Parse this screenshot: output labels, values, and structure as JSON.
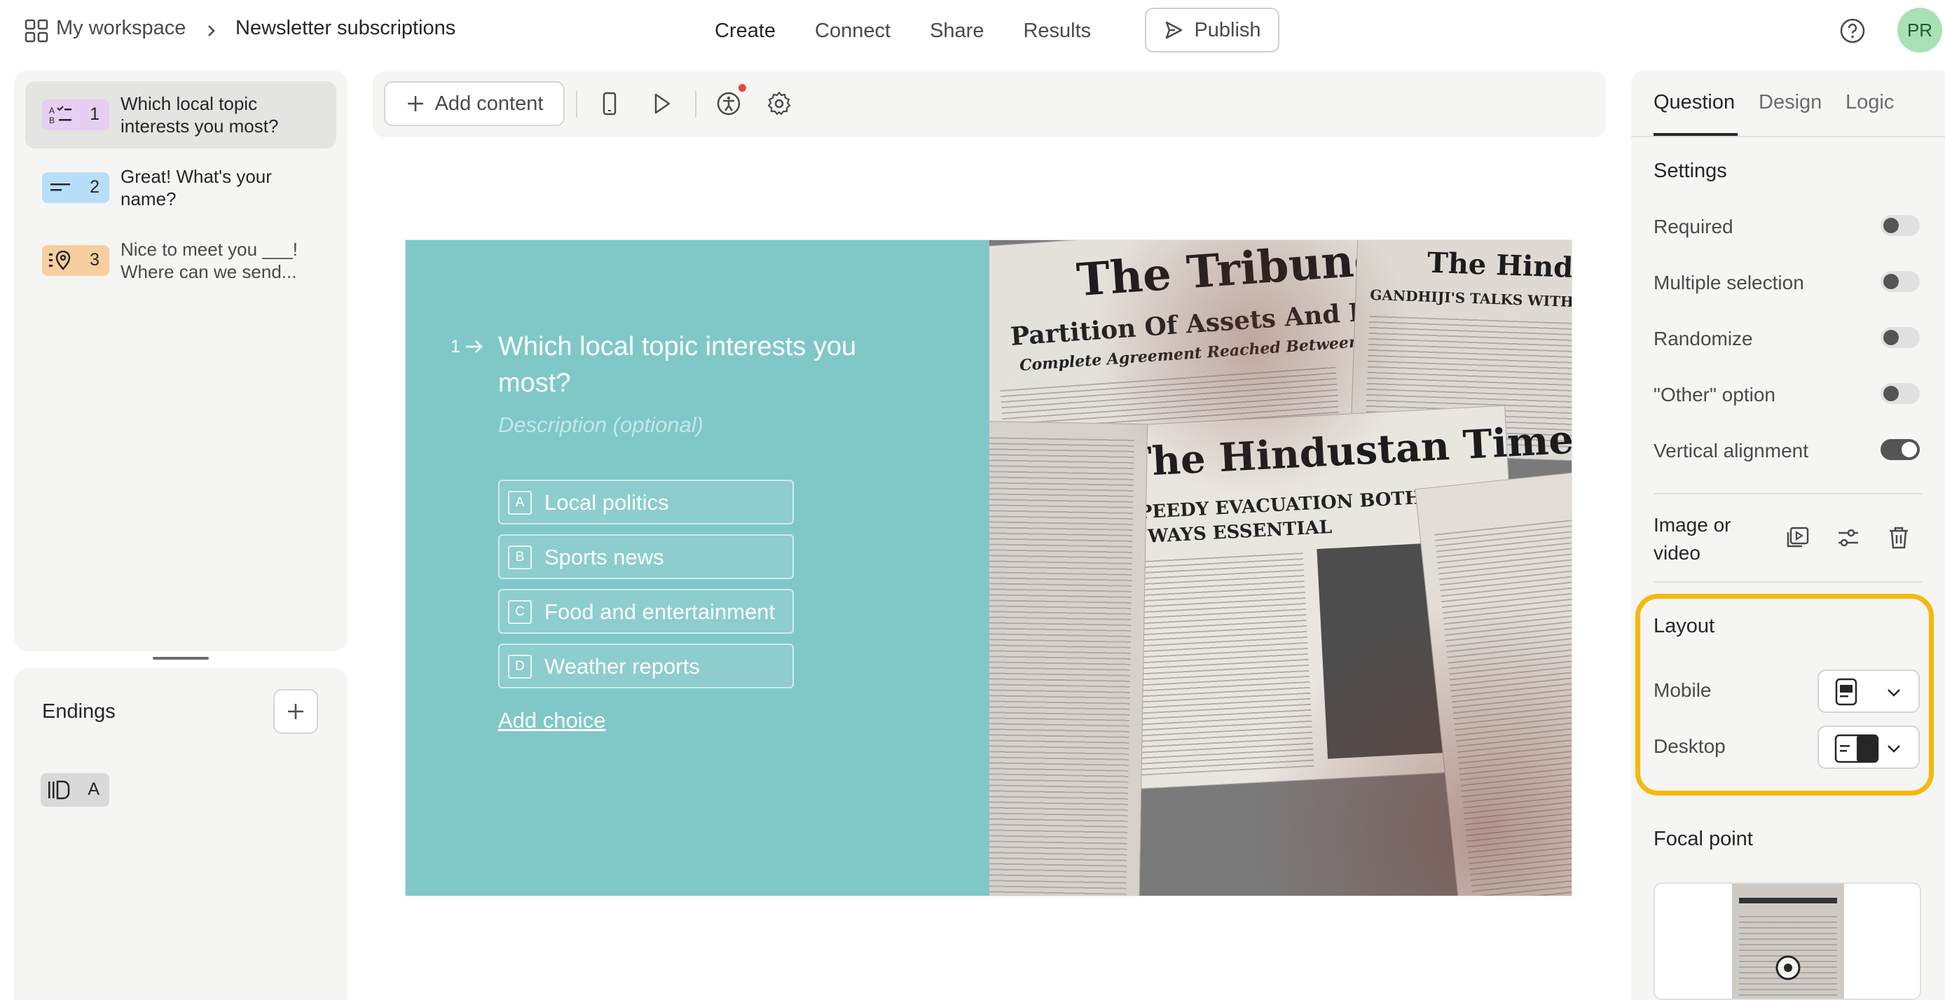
{
  "header": {
    "workspace": "My workspace",
    "form_name": "Newsletter subscriptions",
    "nav": [
      "Create",
      "Connect",
      "Share",
      "Results"
    ],
    "publish_label": "Publish",
    "avatar_initials": "PR"
  },
  "questions": [
    {
      "num": "1",
      "text": "Which local topic interests you most?",
      "color": "#e6cff2",
      "icon": "multiple-choice-icon"
    },
    {
      "num": "2",
      "text": "Great! What's your name?",
      "color": "#b8defa",
      "icon": "short-text-icon"
    },
    {
      "num": "3",
      "text": "Nice to meet you ___! Where can we send...",
      "color": "#f7cf9f",
      "icon": "address-icon"
    }
  ],
  "endings": {
    "title": "Endings",
    "item_label": "A"
  },
  "toolbar": {
    "add_content_label": "Add content"
  },
  "preview": {
    "question_number": "1",
    "question_title": "Which local topic interests you most?",
    "description_placeholder": "Description (optional)",
    "choices": [
      {
        "key": "A",
        "label": "Local politics"
      },
      {
        "key": "B",
        "label": "Sports news"
      },
      {
        "key": "C",
        "label": "Food and entertainment"
      },
      {
        "key": "D",
        "label": "Weather reports"
      }
    ],
    "add_choice_label": "Add choice",
    "background_color": "#80c8c8"
  },
  "right_panel": {
    "tabs": [
      "Question",
      "Design",
      "Logic"
    ],
    "settings_title": "Settings",
    "settings": [
      {
        "label": "Required",
        "on": false
      },
      {
        "label": "Multiple selection",
        "on": false
      },
      {
        "label": "Randomize",
        "on": false
      },
      {
        "label": "\"Other\" option",
        "on": false
      },
      {
        "label": "Vertical alignment",
        "on": true
      }
    ],
    "image_label": "Image or video",
    "layout_title": "Layout",
    "layout_mobile": "Mobile",
    "layout_desktop": "Desktop",
    "focal_title": "Focal point",
    "highlight_color": "#f5b90c"
  }
}
